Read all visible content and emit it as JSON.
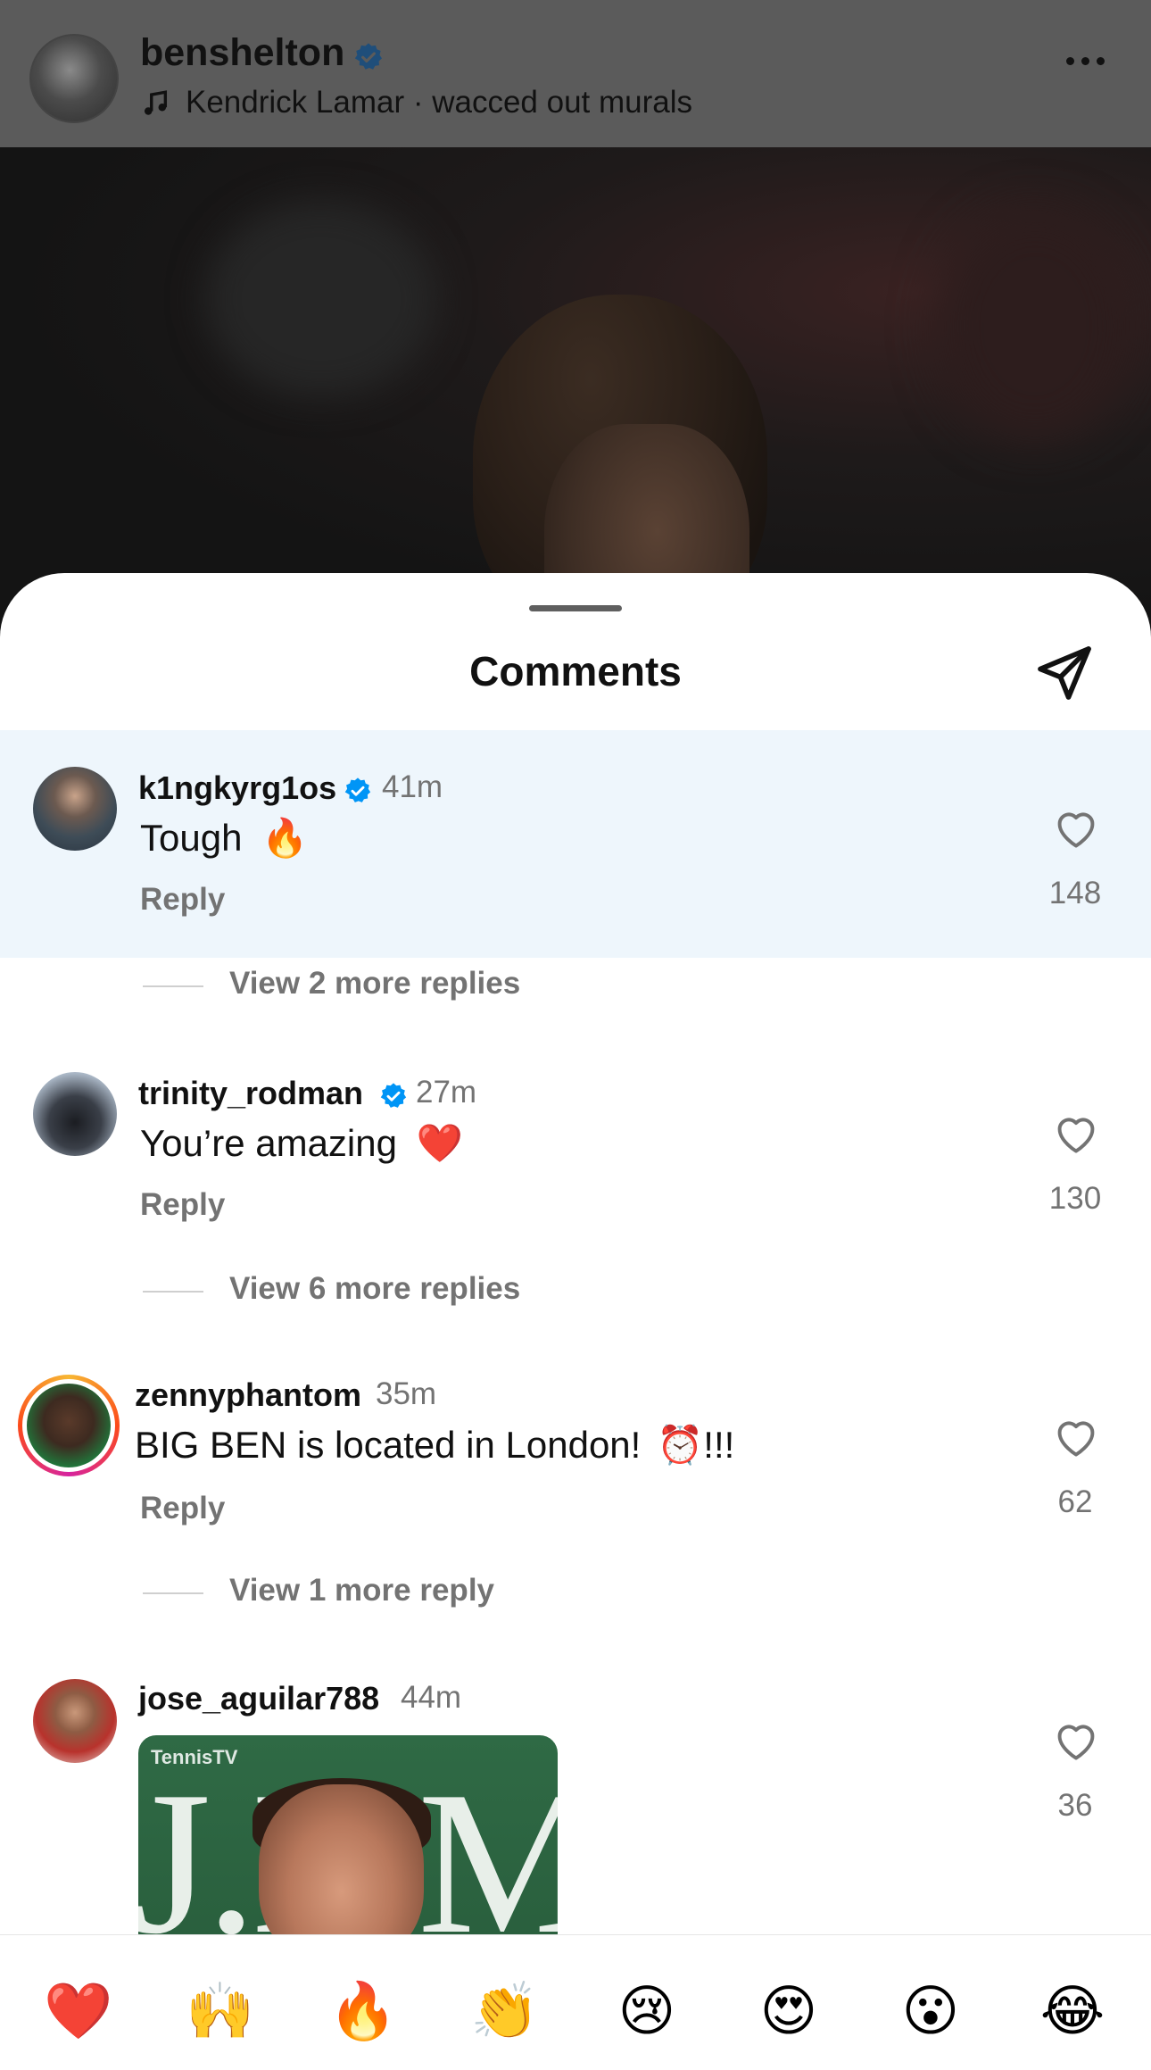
{
  "post": {
    "username": "benshelton",
    "song": "Kendrick Lamar · wacced out murals"
  },
  "sheet": {
    "title": "Comments"
  },
  "comments": [
    {
      "username": "k1ngkyrg1os",
      "verified": true,
      "time": "41m",
      "text": "Tough",
      "emoji": "🔥",
      "reply_label": "Reply",
      "likes": "148",
      "view_replies": "View 2 more replies"
    },
    {
      "username": "trinity_rodman",
      "verified": true,
      "time": "27m",
      "text": "You’re amazing",
      "emoji": "❤️",
      "reply_label": "Reply",
      "likes": "130",
      "view_replies": "View 6 more replies"
    },
    {
      "username": "zennyphantom",
      "verified": false,
      "time": "35m",
      "text": "BIG BEN is located in London!",
      "emoji": "⏰",
      "suffix": "!!!",
      "reply_label": "Reply",
      "likes": "62",
      "view_replies": "View 1 more reply"
    },
    {
      "username": "jose_aguilar788",
      "verified": false,
      "time": "44m",
      "likes": "36",
      "gif": {
        "brand": "TennisTV",
        "text": "J.E Mc"
      }
    }
  ],
  "emoji_bar": [
    "❤️",
    "🙌",
    "🔥",
    "👏",
    "😢",
    "😍",
    "😮",
    "😂"
  ],
  "colors": {
    "verified": "#0095f6",
    "highlight": "#eef6fc",
    "secondary_text": "#737373"
  }
}
